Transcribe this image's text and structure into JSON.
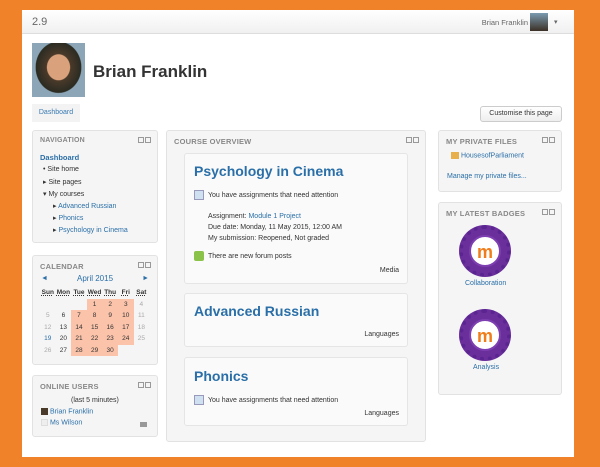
{
  "topbar": {
    "version": "2.9",
    "user": "Brian Franklin",
    "caret": "▾"
  },
  "profile": {
    "name": "Brian Franklin"
  },
  "buttons": {
    "dashboard": "Dashboard",
    "customise": "Customise this page"
  },
  "navigation": {
    "title": "NAVIGATION",
    "items": [
      "Dashboard",
      "Site home",
      "Site pages",
      "My courses",
      "Advanced Russian",
      "Phonics",
      "Psychology in Cinema"
    ]
  },
  "calendar": {
    "title": "CALENDAR",
    "month": "April 2015",
    "prev": "◄",
    "next": "►",
    "days": [
      "Sun",
      "Mon",
      "Tue",
      "Wed",
      "Thu",
      "Fri",
      "Sat"
    ],
    "weeks": [
      [
        "",
        "",
        "",
        "1",
        "2",
        "3",
        "4"
      ],
      [
        "5",
        "6",
        "7",
        "8",
        "9",
        "10",
        "11"
      ],
      [
        "12",
        "13",
        "14",
        "15",
        "16",
        "17",
        "18"
      ],
      [
        "19",
        "20",
        "21",
        "22",
        "23",
        "24",
        "25"
      ],
      [
        "26",
        "27",
        "28",
        "29",
        "30",
        "",
        ""
      ]
    ]
  },
  "online": {
    "title": "ONLINE USERS",
    "subtitle": "(last 5 minutes)",
    "users": [
      "Brian Franklin",
      "Ms Wilson"
    ]
  },
  "overview": {
    "title": "COURSE OVERVIEW",
    "courses": [
      {
        "name": "Psychology in Cinema",
        "assign_notice": "You have assignments that need attention",
        "assignment_label": "Assignment: ",
        "assignment": "Module 1 Project",
        "due": "Due date: Monday, 11 May 2015, 12:00 AM",
        "submission": "My submission: Reopened, Not graded",
        "forum": "There are new forum posts",
        "category": "Media"
      },
      {
        "name": "Advanced Russian",
        "category": "Languages"
      },
      {
        "name": "Phonics",
        "assign_notice": "You have assignments that need attention",
        "category": "Languages"
      }
    ]
  },
  "files": {
    "title": "MY PRIVATE FILES",
    "file": "HousesofParliament",
    "manage": "Manage my private files..."
  },
  "badges": {
    "title": "MY LATEST BADGES",
    "items": [
      "Collaboration",
      "Analysis"
    ],
    "logo": "m"
  }
}
